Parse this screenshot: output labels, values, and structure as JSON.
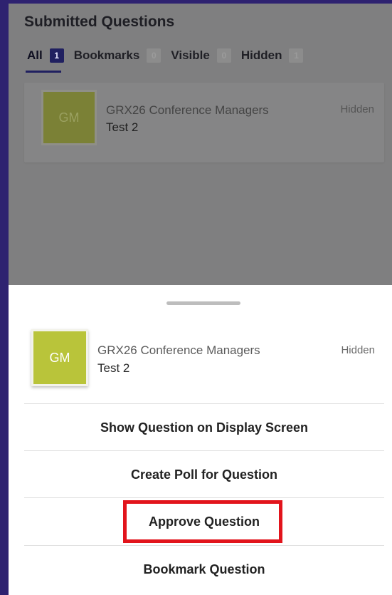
{
  "background": {
    "title": "Submitted Questions",
    "tabs": [
      {
        "label": "All",
        "count": "1"
      },
      {
        "label": "Bookmarks",
        "count": "0"
      },
      {
        "label": "Visible",
        "count": "0"
      },
      {
        "label": "Hidden",
        "count": "1"
      }
    ],
    "card": {
      "avatar_initials": "GM",
      "name": "GRX26 Conference Managers",
      "text": "Test 2",
      "status": "Hidden"
    }
  },
  "sheet": {
    "card": {
      "avatar_initials": "GM",
      "name": "GRX26 Conference Managers",
      "text": "Test 2",
      "status": "Hidden"
    },
    "actions": [
      {
        "label": "Show Question on Display Screen"
      },
      {
        "label": "Create Poll for Question"
      },
      {
        "label": "Approve Question"
      },
      {
        "label": "Bookmark Question"
      }
    ]
  },
  "colors": {
    "frame": "#2e2270",
    "avatar": "#b9c43a",
    "highlight": "#e2141c",
    "active_tab": "#202060"
  }
}
